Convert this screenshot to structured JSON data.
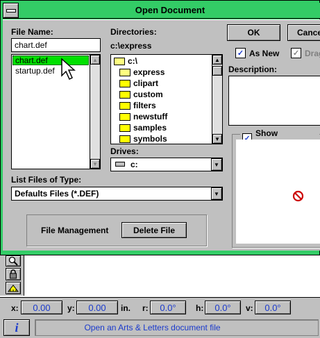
{
  "dialog": {
    "title": "Open Document",
    "file_name_label": "File Name:",
    "file_name_value": "chart.def",
    "files": [
      "chart.def",
      "startup.def"
    ],
    "directories_label": "Directories:",
    "current_dir": "c:\\express",
    "dirs": [
      {
        "name": "c:\\",
        "kind": "open"
      },
      {
        "name": "express",
        "kind": "open"
      },
      {
        "name": "clipart",
        "kind": "closed"
      },
      {
        "name": "custom",
        "kind": "closed"
      },
      {
        "name": "filters",
        "kind": "closed"
      },
      {
        "name": "newstuff",
        "kind": "closed"
      },
      {
        "name": "samples",
        "kind": "closed"
      },
      {
        "name": "symbols",
        "kind": "closed"
      }
    ],
    "drives_label": "Drives:",
    "drive_value": "c:",
    "list_type_label": "List Files of Type:",
    "list_type_value": "Defaults Files (*.DEF)",
    "file_management_label": "File Management",
    "delete_button": "Delete File",
    "ok_button": "OK",
    "cancel_button": "Cance",
    "as_new_label": "As New",
    "drag_label": "Drag",
    "description_label": "Description:",
    "show_thumbnail_label": "Show Thumbnail"
  },
  "status": {
    "x_label": "x:",
    "x_value": "0.00",
    "y_label": "y:",
    "y_value": "0.00",
    "unit": "in.",
    "r_label": "r:",
    "r_value": "0.0°",
    "h_label": "h:",
    "h_value": "0.0°",
    "v_label": "v:",
    "v_value": "0.0°",
    "info_icon": "i",
    "message": "Open an Arts & Letters document file"
  },
  "colors": {
    "frame_green": "#33cc66",
    "selection_green": "#00e000",
    "status_text_blue": "#1a3acc",
    "no_symbol_red": "#cc0000"
  }
}
